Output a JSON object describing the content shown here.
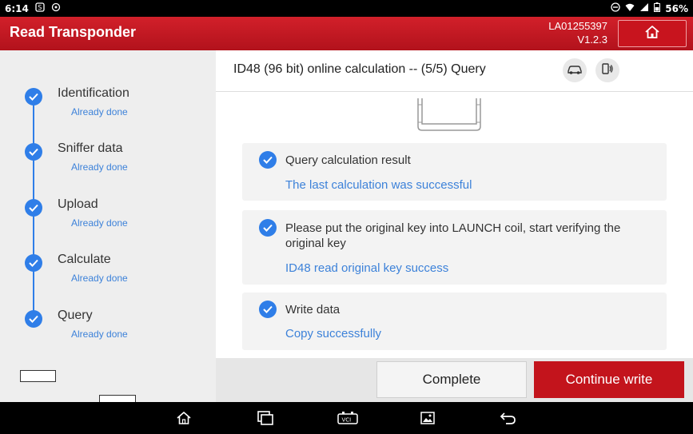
{
  "status_bar": {
    "time": "6:14",
    "battery": "56%",
    "icons": [
      "notification-s-icon",
      "sync-icon",
      "dnd-icon",
      "wifi-icon",
      "signal-icon",
      "battery-icon"
    ]
  },
  "header": {
    "title": "Read Transponder",
    "serial": "LA01255397",
    "version": "V1.2.3",
    "home_icon": "home-icon"
  },
  "sidebar": {
    "steps": [
      {
        "label": "Identification",
        "status": "Already done"
      },
      {
        "label": "Sniffer data",
        "status": "Already done"
      },
      {
        "label": "Upload",
        "status": "Already done"
      },
      {
        "label": "Calculate",
        "status": "Already done"
      },
      {
        "label": "Query",
        "status": "Already done"
      }
    ]
  },
  "main": {
    "title": "ID48 (96 bit) online calculation -- (5/5) Query",
    "header_icons": [
      "car-icon",
      "vci-plug-icon"
    ],
    "cards": [
      {
        "text": "Query calculation result",
        "result": "The last calculation was successful"
      },
      {
        "text": "Please put the original key into LAUNCH coil, start verifying the original key",
        "result": "ID48 read original key success"
      },
      {
        "text": "Write data",
        "result": "Copy successfully"
      }
    ]
  },
  "footer": {
    "complete_label": "Complete",
    "continue_label": "Continue write"
  },
  "nav": {
    "icons": [
      "home-icon",
      "recents-icon",
      "vci-icon",
      "screenshot-icon",
      "back-icon"
    ]
  },
  "colors": {
    "brand_red": "#c3141c",
    "accent_blue": "#2f7ee8",
    "link_blue": "#3d82d9"
  }
}
